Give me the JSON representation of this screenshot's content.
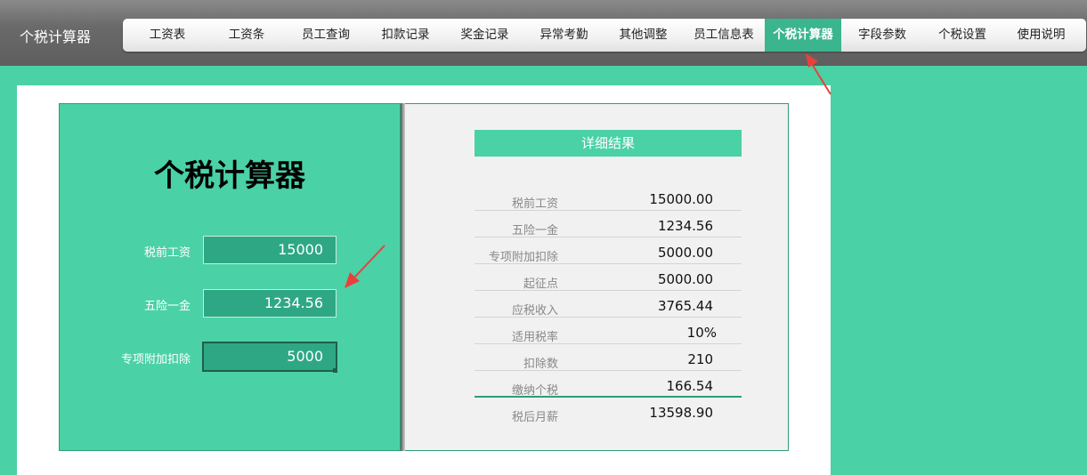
{
  "app": {
    "title": "个税计算器"
  },
  "nav": {
    "items": [
      {
        "label": "工资表"
      },
      {
        "label": "工资条"
      },
      {
        "label": "员工查询"
      },
      {
        "label": "扣款记录"
      },
      {
        "label": "奖金记录"
      },
      {
        "label": "异常考勤"
      },
      {
        "label": "其他调整"
      },
      {
        "label": "员工信息表"
      },
      {
        "label": "个税计算器",
        "active": true
      },
      {
        "label": "字段参数"
      },
      {
        "label": "个税设置"
      },
      {
        "label": "使用说明"
      }
    ]
  },
  "calculator": {
    "title": "个税计算器",
    "fields": [
      {
        "label": "税前工资",
        "value": "15000"
      },
      {
        "label": "五险一金",
        "value": "1234.56"
      },
      {
        "label": "专项附加扣除",
        "value": "5000"
      }
    ]
  },
  "results": {
    "header": "详细结果",
    "rows": [
      {
        "label": "税前工资",
        "value": "15000.00"
      },
      {
        "label": "五险一金",
        "value": "1234.56"
      },
      {
        "label": "专项附加扣除",
        "value": "5000.00"
      },
      {
        "label": "起征点",
        "value": "5000.00"
      },
      {
        "label": "应税收入",
        "value": "3765.44"
      },
      {
        "label": "适用税率",
        "value": "10%"
      },
      {
        "label": "扣除数",
        "value": "210"
      },
      {
        "label": "缴纳个税",
        "value": "166.54"
      },
      {
        "label": "税后月薪",
        "value": "13598.90"
      }
    ]
  },
  "colors": {
    "accent": "#4bd1a6",
    "accent_dark": "#2ea884",
    "nav_active": "#3bb58e",
    "annotation_arrow": "#e8413b"
  }
}
